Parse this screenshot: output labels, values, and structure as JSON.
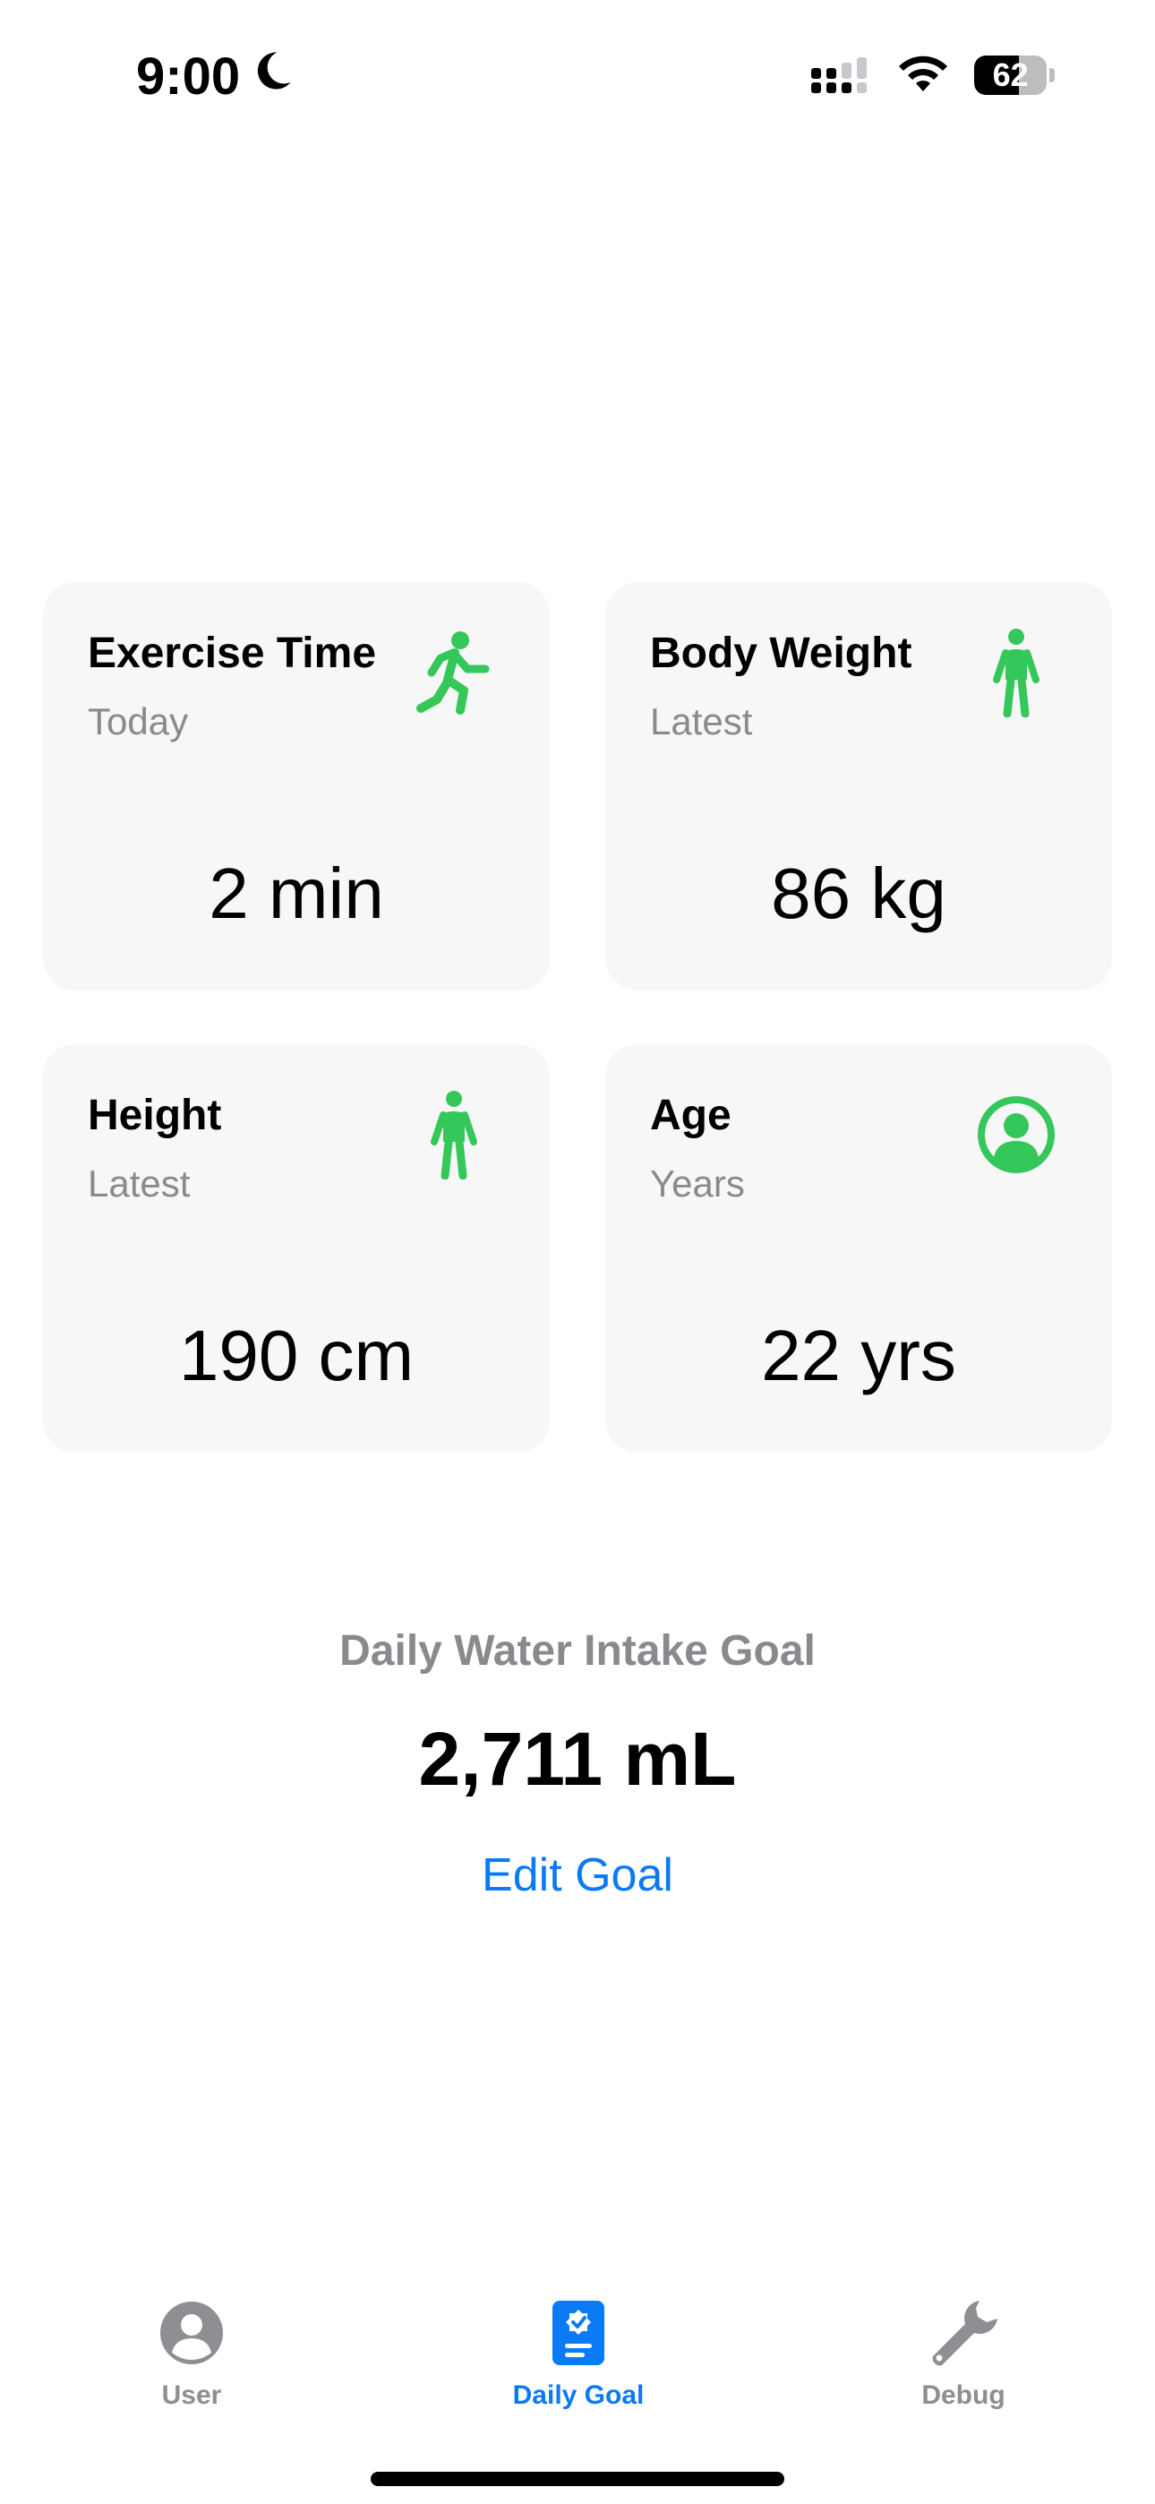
{
  "status_bar": {
    "time": "9:00",
    "focus_icon": "moon-icon",
    "signal_icon": "cellular-signal-icon",
    "wifi_icon": "wifi-icon",
    "battery_percent": 62,
    "battery_label": "62"
  },
  "cards": [
    {
      "title": "Exercise Time",
      "subtitle": "Today",
      "value": "2 min",
      "icon": "running-figure-icon",
      "icon_color": "#34c759"
    },
    {
      "title": "Body Weight",
      "subtitle": "Latest",
      "value": "86 kg",
      "icon": "standing-figure-icon",
      "icon_color": "#34c759"
    },
    {
      "title": "Height",
      "subtitle": "Latest",
      "value": "190 cm",
      "icon": "standing-figure-icon",
      "icon_color": "#34c759"
    },
    {
      "title": "Age",
      "subtitle": "Years",
      "value": "22 yrs",
      "icon": "person-circle-icon",
      "icon_color": "#34c759"
    }
  ],
  "water_goal": {
    "label": "Daily Water Intake Goal",
    "value": "2,711 mL",
    "edit_label": "Edit Goal",
    "link_color": "#0a7af5"
  },
  "tab_bar": {
    "selected": "Daily Goal",
    "active_color": "#0a7af5",
    "inactive_color": "#8e8e93",
    "tabs": [
      {
        "label": "User",
        "icon": "person-circle-icon"
      },
      {
        "label": "Daily Goal",
        "icon": "goal-document-icon"
      },
      {
        "label": "Debug",
        "icon": "wrench-icon"
      }
    ]
  }
}
